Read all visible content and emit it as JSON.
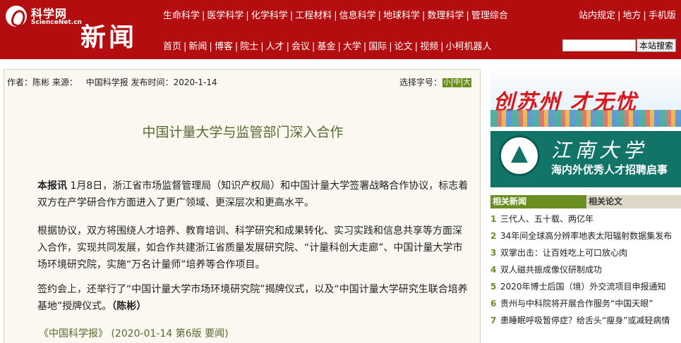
{
  "header": {
    "logo_cn": "科学网",
    "logo_en": "ScienceNet.cn",
    "section_title": "新闻",
    "top_nav": [
      "生命科学",
      "医学科学",
      "化学科学",
      "工程材料",
      "信息科学",
      "地球科学",
      "数理科学",
      "管理综合"
    ],
    "right_nav": [
      "站内规定",
      "地方",
      "手机版"
    ],
    "main_nav": [
      "首页",
      "新闻",
      "博客",
      "院士",
      "人才",
      "会议",
      "基金",
      "大学",
      "国际",
      "论文",
      "视频",
      "小柯机器人"
    ],
    "search": {
      "value": "",
      "button_label": "本站搜索"
    }
  },
  "article": {
    "author_label": "作者：",
    "author": "陈彬",
    "source_label": "来源：",
    "source": "中国科学报",
    "date_label": "发布时间：",
    "date": "2020-1-14",
    "font_size_label": "选择字号：",
    "font_sizes": [
      "小",
      "中",
      "大"
    ],
    "title": "中国计量大学与监管部门深入合作",
    "p1_tag": "本报讯",
    "p1": " 1月8日，浙江省市场监督管理局（知识产权局）和中国计量大学签署战略合作协议，标志着双方在产学研合作方面进入了更广领域、更深层次和更高水平。",
    "p2": "根据协议，双方将围绕人才培养、教育培训、科学研究和成果转化、实习实践和信息共享等方面深入合作，实现共同发展，如合作共建浙江省质量发展研究院、“计量科创大走廊”、中国计量大学市场环境研究院，实施“万名计量师”培养等合作项目。",
    "p3": "签约会上，还举行了“中国计量大学市场环境研究院”揭牌仪式，以及“中国计量大学研究生联合培养基地”授牌仪式。",
    "p3_author": "（陈彬）",
    "source_line": "《中国科学报》 (2020-01-14 第6版 要闻)"
  },
  "sidebar": {
    "banner1_text": "创苏州 才无忧",
    "banner2_school": "江南大学",
    "banner2_sub": "海内外优秀人才招聘启事",
    "tabs": [
      "相关新闻",
      "相关论文"
    ],
    "related_news": [
      "三代人、五十载、两亿年",
      "34年间全球高分辨率地表太阳辐射数据集发布",
      "双掌出击：让百姓吃上可口放心肉",
      "双人磁共振成像仪研制成功",
      "2020年博士后国（境）外交流项目申报通知",
      "贵州与中科院将开展合作服务“中国天眼”",
      "患睡眠呼吸暂停症？给舌头“瘦身”或减轻病情"
    ]
  }
}
